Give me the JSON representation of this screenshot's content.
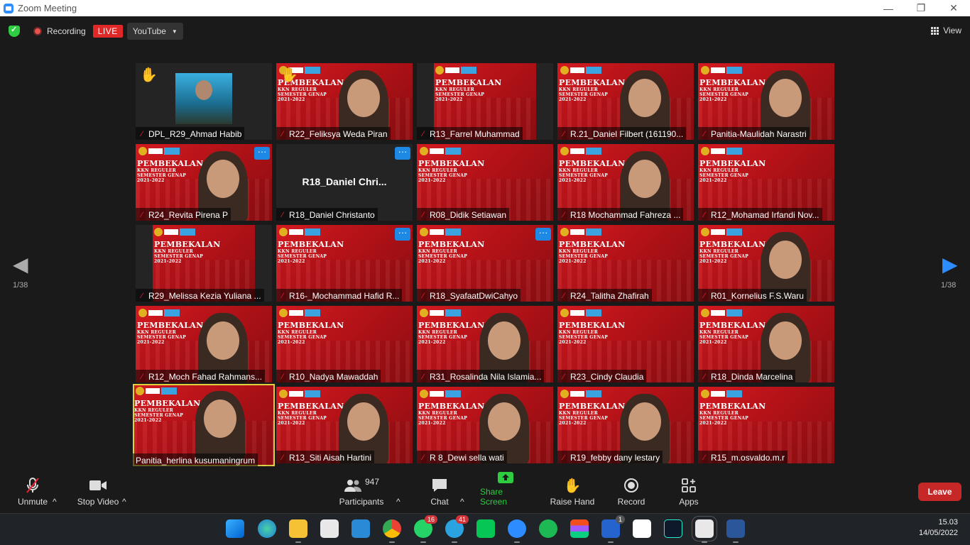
{
  "window": {
    "title": "Zoom Meeting",
    "minimize": "—",
    "restore": "❐",
    "close": "✕"
  },
  "topbar": {
    "recording_label": "Recording",
    "live_badge": "LIVE",
    "stream_target": "YouTube",
    "view_label": "View"
  },
  "pagination": {
    "left": "1/38",
    "right": "1/38"
  },
  "slide_text": {
    "heading": "PEMBEKALAN",
    "sub1": "KKN REGULER",
    "sub2": "SEMESTER GENAP",
    "sub3": "2021-2022"
  },
  "tiles": [
    {
      "name": "DPL_R29_Ahmad Habib",
      "hand": true,
      "more": false,
      "style": "video-dark",
      "mic_off": true
    },
    {
      "name": "R22_Feliksya Weda Piran",
      "hand": true,
      "more": false,
      "style": "slide-person",
      "mic_off": true
    },
    {
      "name": "R13_Farrel Muhammad",
      "hand": false,
      "more": false,
      "style": "slide-cropped",
      "mic_off": true
    },
    {
      "name": "R.21_Daniel Filbert (161190...",
      "hand": false,
      "more": false,
      "style": "slide-person",
      "mic_off": true
    },
    {
      "name": "Panitia-Maulidah Narastri",
      "hand": false,
      "more": false,
      "style": "slide-person",
      "mic_off": true
    },
    {
      "name": "R24_Revita Pirena P",
      "hand": false,
      "more": true,
      "style": "slide-person",
      "mic_off": true
    },
    {
      "name": "R18_Daniel Christanto",
      "hand": false,
      "more": true,
      "style": "name-only",
      "big_name": "R18_Daniel  Chri...",
      "mic_off": true
    },
    {
      "name": "R08_Didik Setiawan",
      "hand": false,
      "more": false,
      "style": "slide",
      "mic_off": true
    },
    {
      "name": "R18 Mochammad Fahreza ...",
      "hand": false,
      "more": false,
      "style": "slide-person",
      "mic_off": true
    },
    {
      "name": "R12_Mohamad Irfandi Nov...",
      "hand": false,
      "more": false,
      "style": "slide",
      "mic_off": true
    },
    {
      "name": "R29_Melissa Kezia Yuliana ...",
      "hand": false,
      "more": false,
      "style": "slide-cropped",
      "mic_off": true
    },
    {
      "name": "R16-_Mochammad Hafid R...",
      "hand": false,
      "more": true,
      "style": "slide",
      "mic_off": true
    },
    {
      "name": "R18_SyafaatDwiCahyo",
      "hand": false,
      "more": true,
      "style": "slide",
      "mic_off": true
    },
    {
      "name": "R24_Talitha Zhafirah",
      "hand": false,
      "more": false,
      "style": "slide",
      "mic_off": true
    },
    {
      "name": "R01_Kornelius F.S.Waru",
      "hand": false,
      "more": false,
      "style": "slide-person",
      "mic_off": true
    },
    {
      "name": "R12_Moch Fahad Rahmans...",
      "hand": false,
      "more": false,
      "style": "slide-person",
      "mic_off": true
    },
    {
      "name": "R10_Nadya Mawaddah",
      "hand": false,
      "more": false,
      "style": "slide",
      "mic_off": true
    },
    {
      "name": "R31_Rosalinda Nila Islamia...",
      "hand": false,
      "more": false,
      "style": "slide-person",
      "mic_off": true
    },
    {
      "name": "R23_Cindy Claudia",
      "hand": false,
      "more": false,
      "style": "slide",
      "mic_off": true
    },
    {
      "name": "R18_Dinda Marcelina",
      "hand": false,
      "more": false,
      "style": "slide-person",
      "mic_off": true
    },
    {
      "name": "Panitia_herlina kusumaningrum",
      "hand": false,
      "more": false,
      "style": "slide-person",
      "active": true,
      "mic_off": false
    },
    {
      "name": "R13_Siti Aisah Hartini",
      "hand": false,
      "more": false,
      "style": "slide-person",
      "mic_off": true
    },
    {
      "name": "R 8_Dewi sella wati",
      "hand": false,
      "more": false,
      "style": "slide-person",
      "mic_off": true
    },
    {
      "name": "R19_febby dany lestary",
      "hand": false,
      "more": false,
      "style": "slide-person",
      "mic_off": true
    },
    {
      "name": "R15_m.osvaldo.m.r",
      "hand": false,
      "more": false,
      "style": "slide",
      "mic_off": true
    }
  ],
  "toolbar": {
    "unmute": "Unmute",
    "stop_video": "Stop Video",
    "participants_count": "947",
    "participants": "Participants",
    "chat": "Chat",
    "share_screen": "Share Screen",
    "raise_hand": "Raise Hand",
    "record": "Record",
    "apps": "Apps",
    "leave": "Leave"
  },
  "taskbar": {
    "whatsapp_badge": "16",
    "telegram_badge": "41",
    "todo_badge": "1",
    "time": "15.03",
    "date": "14/05/2022"
  },
  "colors": {
    "live": "#e02828",
    "share_green": "#2ecc40",
    "leave": "#c62828",
    "tile_red": "#c0141a",
    "active_outline": "#e0d040"
  }
}
